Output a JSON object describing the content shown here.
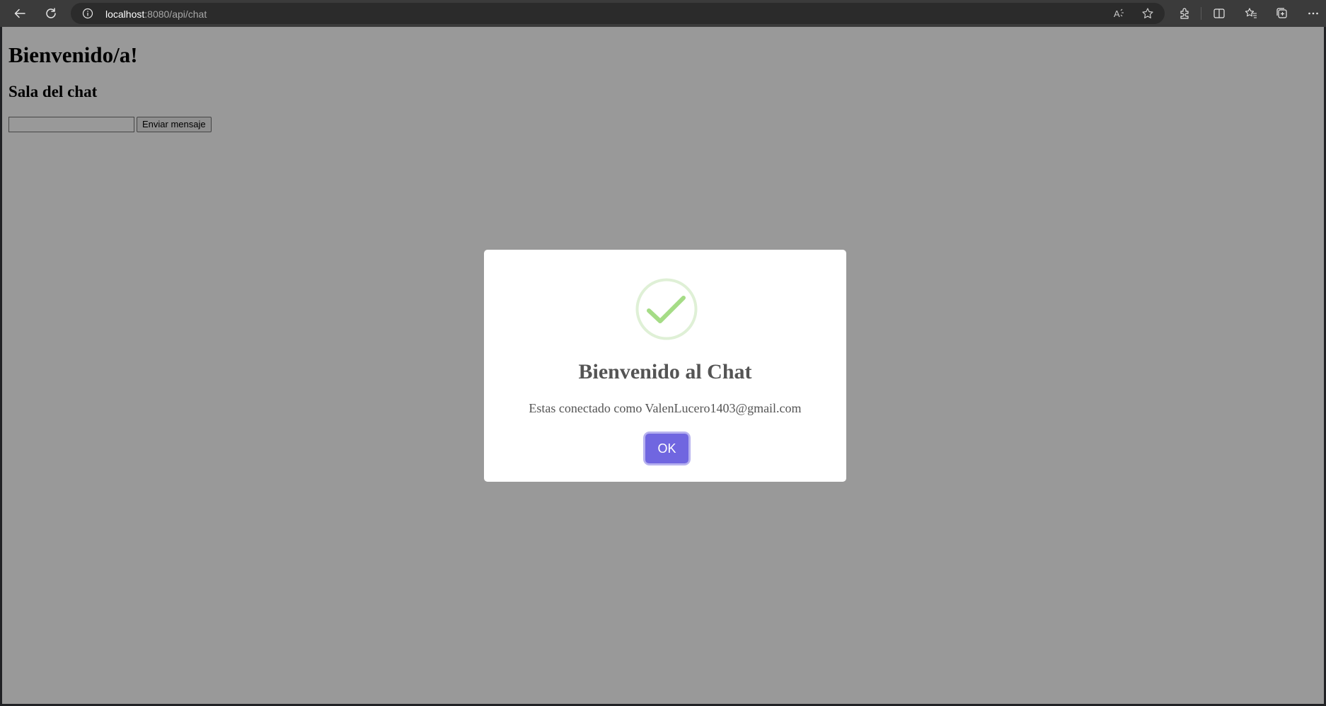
{
  "browser": {
    "url_host": "localhost",
    "url_path": ":8080/api/chat",
    "icons": [
      "back-icon",
      "refresh-icon",
      "site-info-icon",
      "read-aloud-icon",
      "favorite-star-icon",
      "extensions-icon",
      "split-screen-icon",
      "favorites-icon",
      "collections-icon",
      "more-icon"
    ]
  },
  "page": {
    "heading": "Bienvenido/a!",
    "subheading": "Sala del chat",
    "message_input": {
      "value": "",
      "placeholder": ""
    },
    "send_button_label": "Enviar mensaje"
  },
  "modal": {
    "title": "Bienvenido al Chat",
    "text": "Estas conectado como ValenLucero1403@gmail.com",
    "confirm_label": "OK",
    "icon": "success-check-icon",
    "colors": {
      "confirm": "#7066e0",
      "success_ring": "#dff0d6",
      "success_check": "#a5dc86",
      "text": "#545454"
    }
  }
}
